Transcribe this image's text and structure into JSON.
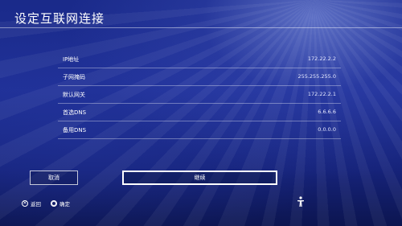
{
  "header": {
    "title": "设定互联网连接"
  },
  "settings": [
    {
      "label": "IP地址",
      "value": "172.22.2.2"
    },
    {
      "label": "子网掩码",
      "value": "255.255.255.0"
    },
    {
      "label": "默认网关",
      "value": "172.22.2.1"
    },
    {
      "label": "首选DNS",
      "value": "6.6.6.6"
    },
    {
      "label": "备用DNS",
      "value": "0.0.0.0"
    }
  ],
  "buttons": {
    "cancel_label": "取消",
    "continue_label": "继续"
  },
  "footer": {
    "back_label": "返回",
    "confirm_label": "确定",
    "back_icon": "cross-icon",
    "confirm_icon": "circle-icon"
  },
  "colors": {
    "background": "#1f2f95",
    "text": "#ffffff"
  }
}
